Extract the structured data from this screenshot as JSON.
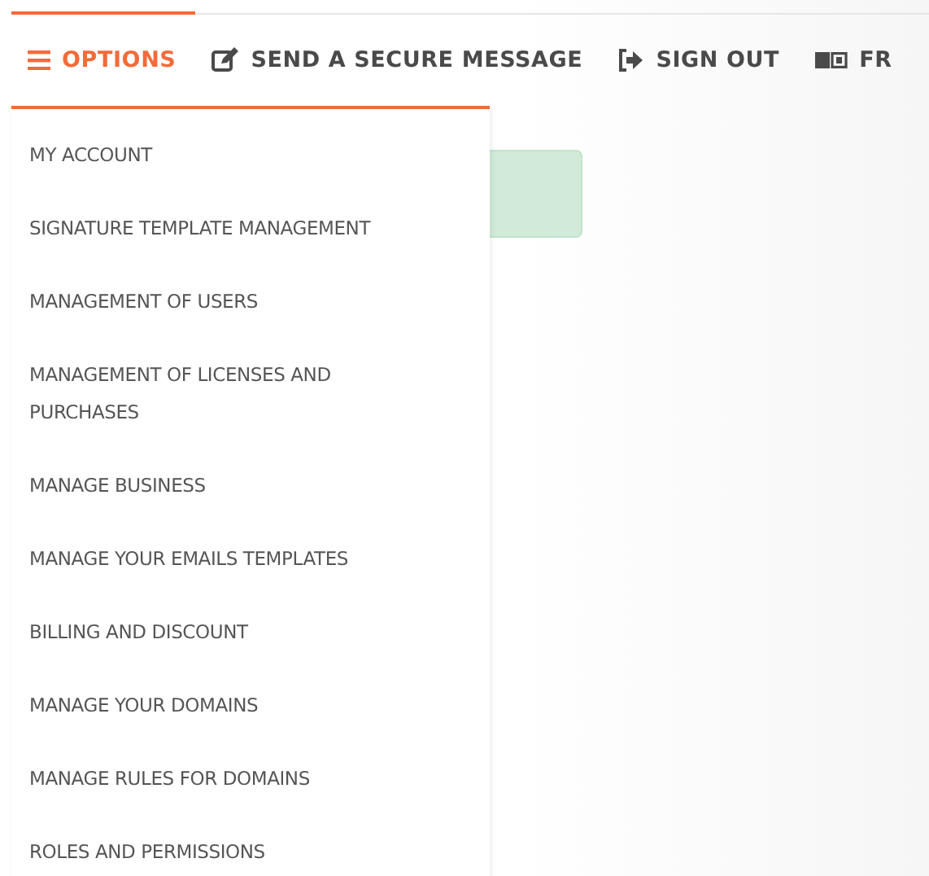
{
  "nav": [
    {
      "kind": "menu",
      "label": "OPTIONS",
      "selected": true
    },
    {
      "kind": "message",
      "label": "SEND A SECURE MESSAGE",
      "selected": false
    },
    {
      "kind": "signout",
      "label": "SIGN OUT",
      "selected": false
    },
    {
      "kind": "language",
      "label": "FR",
      "selected": false
    }
  ],
  "options_menu": {
    "expanded": true,
    "items": [
      "MY ACCOUNT",
      "SIGNATURE TEMPLATE MANAGEMENT",
      "MANAGEMENT OF USERS",
      "MANAGEMENT OF LICENSES AND PURCHASES",
      "MANAGE BUSINESS",
      "MANAGE YOUR EMAILS TEMPLATES",
      "BILLING AND DISCOUNT",
      "MANAGE YOUR DOMAINS",
      "MANAGE RULES FOR DOMAINS",
      "ROLES AND PERMISSIONS"
    ]
  }
}
